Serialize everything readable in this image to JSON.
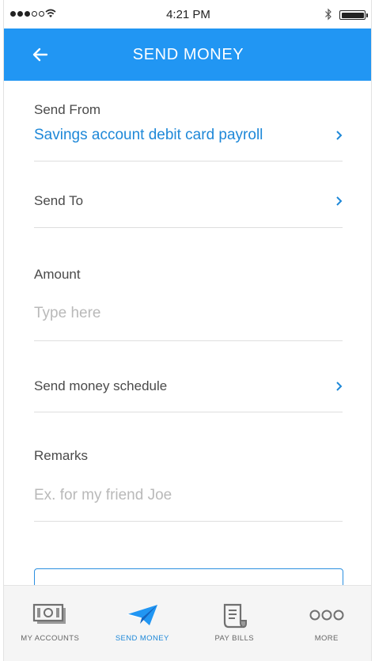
{
  "status_bar": {
    "time": "4:21 PM"
  },
  "header": {
    "title": "SEND MONEY",
    "back_icon": "arrow-left-icon",
    "background_color": "#2196f3"
  },
  "form": {
    "send_from": {
      "label": "Send From",
      "value": "Savings account debit card payroll"
    },
    "send_to": {
      "label": "Send To"
    },
    "amount": {
      "label": "Amount",
      "placeholder": "Type here"
    },
    "schedule": {
      "label": "Send money schedule"
    },
    "remarks": {
      "label": "Remarks",
      "placeholder": "Ex. for my friend Joe"
    }
  },
  "bottom_nav": {
    "items": [
      {
        "label": "MY ACCOUNTS",
        "icon": "cash-icon",
        "active": false
      },
      {
        "label": "SEND MONEY",
        "icon": "paper-plane-icon",
        "active": true
      },
      {
        "label": "PAY BILLS",
        "icon": "bill-icon",
        "active": false
      },
      {
        "label": "MORE",
        "icon": "more-dots-icon",
        "active": false
      }
    ]
  },
  "colors": {
    "accent": "#2196f3",
    "link": "#1e88d8"
  }
}
